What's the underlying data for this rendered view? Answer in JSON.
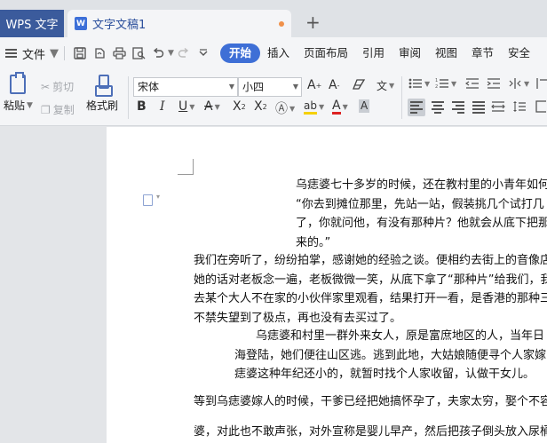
{
  "tabs": {
    "app_label": "WPS 文字",
    "doc_label": "文字文稿1",
    "new_tab": "+"
  },
  "menu": {
    "file_label": "文件",
    "tabs": [
      "开始",
      "插入",
      "页面布局",
      "引用",
      "审阅",
      "视图",
      "章节",
      "安全"
    ],
    "active_tab": "开始"
  },
  "ribbon": {
    "paste": "粘贴",
    "cut": "剪切",
    "copy": "复制",
    "format_painter": "格式刷",
    "font_name": "宋体",
    "font_size": "小四"
  },
  "document": {
    "paragraphs": [
      [
        "乌痣婆七十多岁的时候，还在教村里的小青年如何",
        "“你去到摊位那里，先站一站，假装挑几个试打几",
        "了，你就问他，有没有那种片？他就会从底下把那",
        "来的。”"
      ],
      [
        "我们在旁听了，纷纷拍掌，感谢她的经验之谈。便相约去街上的音像店",
        "她的话对老板念一遍，老板微微一笑，从底下拿了“那种片”给我们，我",
        "去某个大人不在家的小伙伴家里观看，结果打开一看，是香港的那种三",
        "不禁失望到了极点，再也没有去买过了。"
      ],
      [
        "乌痣婆和村里一群外来女人，原是富庶地区的人，当年日",
        "海登陆，她们便往山区逃。逃到此地，大姑娘随便寻个人家嫁",
        "痣婆这种年纪还小的，就暂时找个人家收留，认做干女儿。"
      ],
      [
        "等到乌痣婆嫁人的时候，干爹已经把她搞怀孕了，夫家太穷，娶个不容易"
      ],
      [
        "婆，对此也不敢声张，对外宣称是婴儿早产，然后把孩子倒头放入尿桶"
      ]
    ]
  },
  "colors": {
    "accent": "#3e6fd6",
    "app_tab": "#3b5b9c",
    "unsaved_dot": "#f0914a"
  }
}
